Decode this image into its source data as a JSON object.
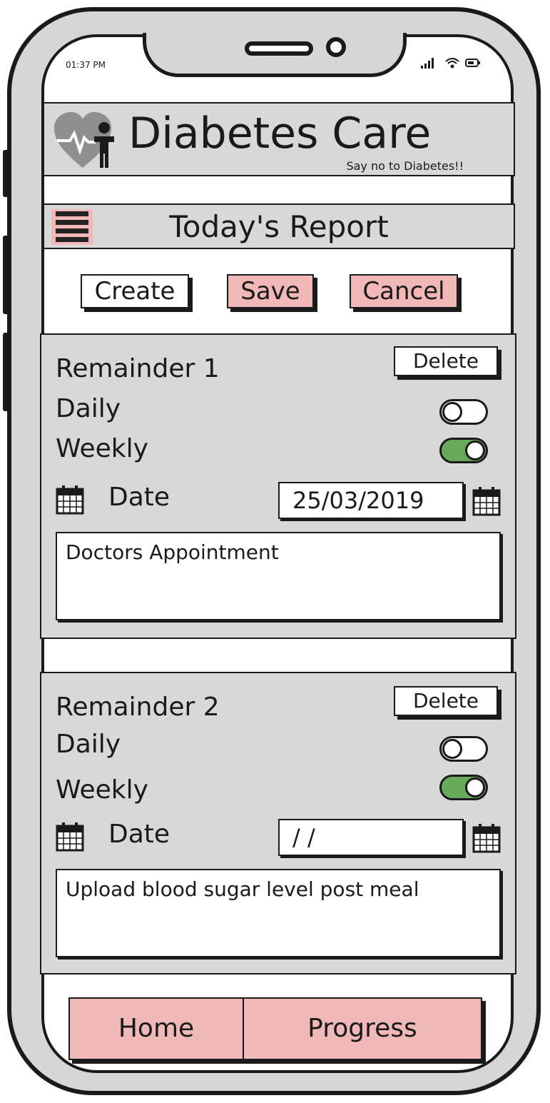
{
  "status_bar": {
    "time": "01:37 PM",
    "icons": [
      "signal-icon",
      "wifi-icon",
      "battery-icon"
    ]
  },
  "app": {
    "title": "Diabetes Care",
    "tagline": "Say no to Diabetes!!",
    "logo_icon": "heart-pulse-person-icon"
  },
  "title_bar": {
    "menu_icon": "hamburger-menu-icon",
    "title": "Today's Report"
  },
  "actions": {
    "create": "Create",
    "save": "Save",
    "cancel": "Cancel"
  },
  "reminders": [
    {
      "label": "Remainder 1",
      "delete_label": "Delete",
      "daily_label": "Daily",
      "daily_on": false,
      "weekly_label": "Weekly",
      "weekly_on": true,
      "date_label": "Date",
      "date_value": "25/03/2019",
      "note": "Doctors Appointment"
    },
    {
      "label": "Remainder 2",
      "delete_label": "Delete",
      "daily_label": "Daily",
      "daily_on": false,
      "weekly_label": "Weekly",
      "weekly_on": true,
      "date_label": "Date",
      "date_value": "/ /",
      "note": "Upload blood sugar level post meal"
    }
  ],
  "bottom_nav": {
    "home": "Home",
    "progress": "Progress"
  },
  "colors": {
    "accent_pink": "#f1b8b8",
    "panel_gray": "#d8d8d8",
    "toggle_on": "#69aa5a"
  }
}
